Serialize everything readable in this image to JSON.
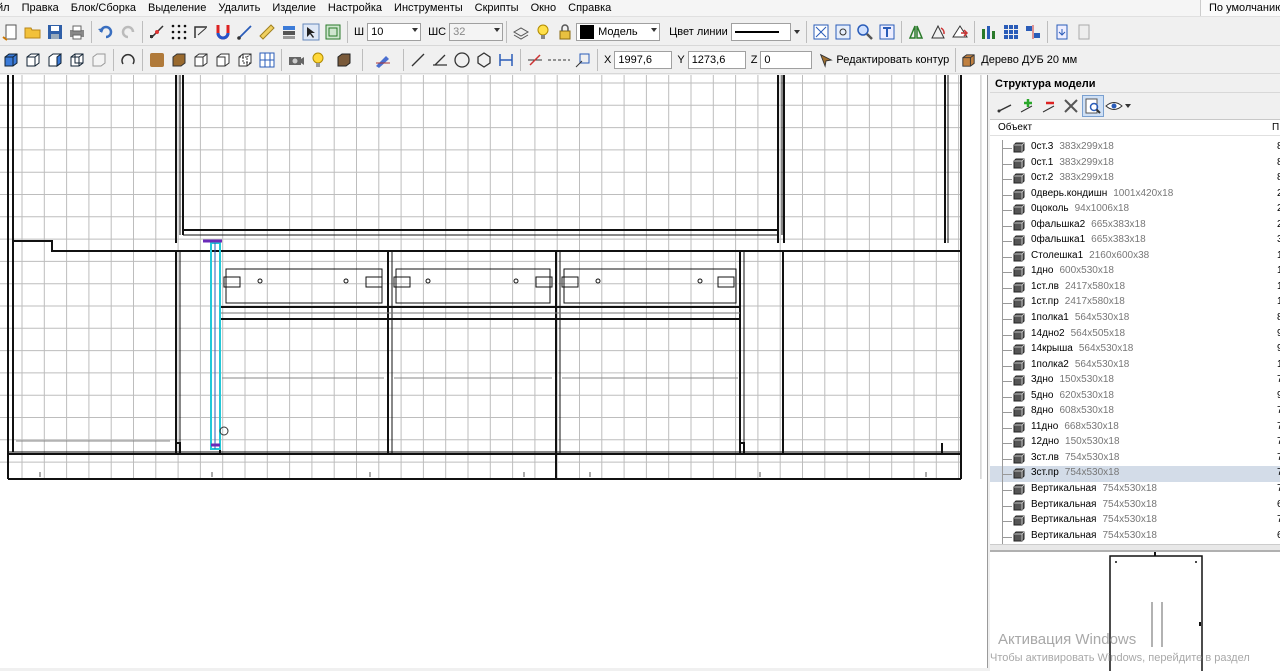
{
  "menu": {
    "items": [
      "йл",
      "Правка",
      "Блок/Сборка",
      "Выделение",
      "Удалить",
      "Изделие",
      "Настройка",
      "Инструменты",
      "Скрипты",
      "Окно",
      "Справка"
    ],
    "right_combo": "По умолчанию"
  },
  "toolbar1": {
    "width_label": "Ш",
    "width_value": "10",
    "step_label": "ШС",
    "step_value": "32",
    "layer_value": "Модель",
    "line_color_label": "Цвет линии"
  },
  "toolbar2": {
    "x_label": "X",
    "x_value": "1997,6",
    "y_label": "Y",
    "y_value": "1273,6",
    "z_label": "Z",
    "z_value": "0",
    "edit_contour_label": "Редактировать контур",
    "material_label": "Дерево ДУБ 20 мм"
  },
  "panel": {
    "title": "Структура модели",
    "col_object": "Объект",
    "col_extra": "П"
  },
  "tree": [
    {
      "name": "0ст.3",
      "dim": "383x299x18",
      "extra": "8"
    },
    {
      "name": "0ст.1",
      "dim": "383x299x18",
      "extra": "8"
    },
    {
      "name": "0ст.2",
      "dim": "383x299x18",
      "extra": "8"
    },
    {
      "name": "0дверь.кондишн",
      "dim": "1001x420x18",
      "extra": "2"
    },
    {
      "name": "0цоколь",
      "dim": "94x1006x18",
      "extra": "2"
    },
    {
      "name": "0фальшка2",
      "dim": "665x383x18",
      "extra": "2"
    },
    {
      "name": "0фальшка1",
      "dim": "665x383x18",
      "extra": "3"
    },
    {
      "name": "Столешка1",
      "dim": "2160x600x38",
      "extra": "1"
    },
    {
      "name": "1дно",
      "dim": "600x530x18",
      "extra": "1"
    },
    {
      "name": "1ст.лв",
      "dim": "2417x580x18",
      "extra": "1"
    },
    {
      "name": "1ст.пр",
      "dim": "2417x580x18",
      "extra": "1"
    },
    {
      "name": "1полка1",
      "dim": "564x530x18",
      "extra": "8"
    },
    {
      "name": "14дно2",
      "dim": "564x505x18",
      "extra": "9"
    },
    {
      "name": "14крыша",
      "dim": "564x530x18",
      "extra": "9"
    },
    {
      "name": "1полка2",
      "dim": "564x530x18",
      "extra": "1"
    },
    {
      "name": "3дно",
      "dim": "150x530x18",
      "extra": "7"
    },
    {
      "name": "5дно",
      "dim": "620x530x18",
      "extra": "9"
    },
    {
      "name": "8дно",
      "dim": "608x530x18",
      "extra": "7"
    },
    {
      "name": "11дно",
      "dim": "668x530x18",
      "extra": "7"
    },
    {
      "name": "12дно",
      "dim": "150x530x18",
      "extra": "7"
    },
    {
      "name": "3ст.лв",
      "dim": "754x530x18",
      "extra": "7"
    },
    {
      "name": "3ст.пр",
      "dim": "754x530x18",
      "extra": "7"
    },
    {
      "name": "Вертикальная",
      "dim": "754x530x18",
      "extra": "7"
    },
    {
      "name": "Вертикальная",
      "dim": "754x530x18",
      "extra": "6"
    },
    {
      "name": "Вертикальная",
      "dim": "754x530x18",
      "extra": "7"
    },
    {
      "name": "Вертикальная",
      "dim": "754x530x18",
      "extra": "6"
    }
  ],
  "selected_row": 21,
  "watermark": {
    "line1": "Активация Windows",
    "line2": "Чтобы активировать Windows, перейдите в раздел"
  }
}
